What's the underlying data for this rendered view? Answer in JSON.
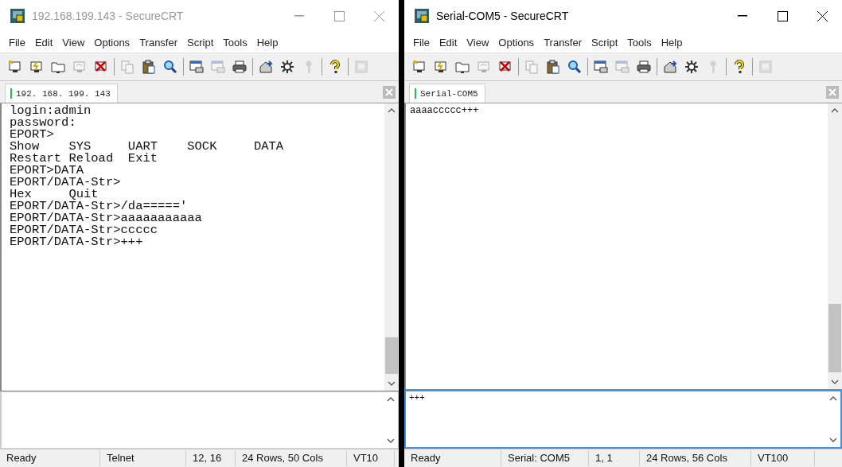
{
  "windows": [
    {
      "title": "192.168.199.143 - SecureCRT",
      "active": false,
      "menu": [
        "File",
        "Edit",
        "View",
        "Options",
        "Transfer",
        "Script",
        "Tools",
        "Help"
      ],
      "toolbar": [
        {
          "kind": "connect",
          "disabled": false
        },
        {
          "kind": "quick",
          "disabled": false
        },
        {
          "kind": "folder",
          "disabled": false
        },
        {
          "kind": "reconnect",
          "disabled": true
        },
        {
          "kind": "disconnect",
          "disabled": false
        },
        {
          "kind": "separator"
        },
        {
          "kind": "copy",
          "disabled": true
        },
        {
          "kind": "paste",
          "disabled": false
        },
        {
          "kind": "find",
          "disabled": false
        },
        {
          "kind": "separator"
        },
        {
          "kind": "window",
          "disabled": false
        },
        {
          "kind": "window",
          "disabled": true
        },
        {
          "kind": "printer",
          "disabled": false
        },
        {
          "kind": "separator"
        },
        {
          "kind": "options",
          "disabled": false
        },
        {
          "kind": "gear",
          "disabled": false
        },
        {
          "kind": "key",
          "disabled": true
        },
        {
          "kind": "separator"
        },
        {
          "kind": "help",
          "disabled": false
        },
        {
          "kind": "separator"
        },
        {
          "kind": "map",
          "disabled": true
        }
      ],
      "tab": {
        "label": "192. 168. 199. 143"
      },
      "terminal_lines": [
        "login:admin",
        "password:",
        "EPORT>",
        "Show    SYS     UART    SOCK     DATA",
        "Restart Reload  Exit",
        "EPORT>DATA",
        "EPORT/DATA-Str>",
        "Hex     Quit",
        "EPORT/DATA-Str>/da=====' ",
        "EPORT/DATA-Str>aaaaaaaaaaa",
        "EPORT/DATA-Str>ccccc",
        "EPORT/DATA-Str>+++"
      ],
      "command_focused": false,
      "status_bar": [
        "Ready",
        "Telnet",
        "12,  16",
        "24 Rows,  50 Cols",
        "VT10"
      ]
    },
    {
      "title": "Serial-COM5 - SecureCRT",
      "active": true,
      "menu": [
        "File",
        "Edit",
        "View",
        "Options",
        "Transfer",
        "Script",
        "Tools",
        "Help"
      ],
      "toolbar": [
        {
          "kind": "connect",
          "disabled": false
        },
        {
          "kind": "quick",
          "disabled": false
        },
        {
          "kind": "folder",
          "disabled": false
        },
        {
          "kind": "reconnect",
          "disabled": true
        },
        {
          "kind": "disconnect",
          "disabled": false
        },
        {
          "kind": "separator"
        },
        {
          "kind": "copy",
          "disabled": true
        },
        {
          "kind": "paste",
          "disabled": false
        },
        {
          "kind": "find",
          "disabled": false
        },
        {
          "kind": "separator"
        },
        {
          "kind": "window",
          "disabled": false
        },
        {
          "kind": "window",
          "disabled": true
        },
        {
          "kind": "printer",
          "disabled": false
        },
        {
          "kind": "separator"
        },
        {
          "kind": "options",
          "disabled": false
        },
        {
          "kind": "gear",
          "disabled": false
        },
        {
          "kind": "key",
          "disabled": true
        },
        {
          "kind": "separator"
        },
        {
          "kind": "help",
          "disabled": false
        },
        {
          "kind": "separator"
        },
        {
          "kind": "map",
          "disabled": true
        }
      ],
      "tab": {
        "label": "Serial-COM5"
      },
      "terminal_lines": [
        "aaaaccccc+++"
      ],
      "command_text": "+++",
      "command_focused": true,
      "status_bar": [
        "Ready",
        "Serial: COM5",
        "1,  1",
        "24 Rows,  56 Cols",
        "VT100"
      ]
    }
  ]
}
